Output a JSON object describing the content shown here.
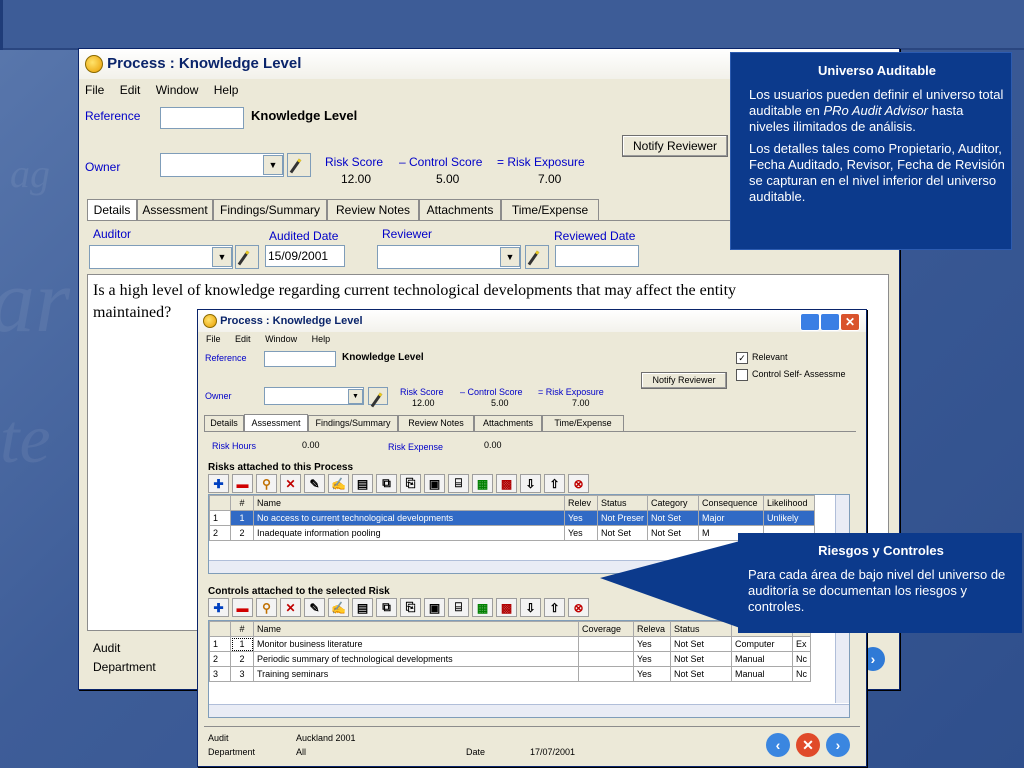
{
  "back_window": {
    "title": "Process : Knowledge Level",
    "menu": [
      "File",
      "Edit",
      "Window",
      "Help"
    ],
    "reference_label": "Reference",
    "reference_value": "Knowledge Level",
    "notify_button": "Notify Reviewer",
    "owner_label": "Owner",
    "risk_score_label": "Risk Score",
    "control_score_label": "– Control Score",
    "risk_exposure_label": "= Risk Exposure",
    "risk_score": "12.00",
    "control_score": "5.00",
    "risk_exposure": "7.00",
    "tabs": [
      "Details",
      "Assessment",
      "Findings/Summary",
      "Review Notes",
      "Attachments",
      "Time/Expense"
    ],
    "auditor_label": "Auditor",
    "audited_date_label": "Audited Date",
    "audited_date": "15/09/2001",
    "reviewer_label": "Reviewer",
    "reviewed_date_label": "Reviewed Date",
    "question": "Is a high level of knowledge regarding current technological developments that may affect the entity maintained?",
    "footer_audit": "Audit",
    "footer_department": "Department"
  },
  "front_window": {
    "title": "Process : Knowledge Level",
    "menu": [
      "File",
      "Edit",
      "Window",
      "Help"
    ],
    "reference_label": "Reference",
    "reference_value": "Knowledge Level",
    "relevant_label": "Relevant",
    "self_assess_label": "Control Self- Assessme",
    "notify_button": "Notify Reviewer",
    "owner_label": "Owner",
    "risk_score_label": "Risk Score",
    "control_score_label": "– Control Score",
    "risk_exposure_label": "= Risk Exposure",
    "risk_score": "12.00",
    "control_score": "5.00",
    "risk_exposure": "7.00",
    "tabs": [
      "Details",
      "Assessment",
      "Findings/Summary",
      "Review Notes",
      "Attachments",
      "Time/Expense"
    ],
    "risk_hours_label": "Risk Hours",
    "risk_hours": "0.00",
    "risk_expense_label": "Risk Expense",
    "risk_expense": "0.00",
    "risks_heading": "Risks attached to this Process",
    "risks_columns": [
      "",
      "#",
      "Name",
      "Relev",
      "Status",
      "Category",
      "Consequence",
      "Likelihood"
    ],
    "risks_rows": [
      [
        "1",
        "1",
        "No access to current technological developments",
        "Yes",
        "Not Preser",
        "Not Set",
        "Major",
        "Unlikely"
      ],
      [
        "2",
        "2",
        "Inadequate information pooling",
        "Yes",
        "Not Set",
        "Not Set",
        "M",
        ""
      ]
    ],
    "controls_heading": "Controls attached to the selected Risk",
    "controls_columns": [
      "",
      "#",
      "Name",
      "Coverage",
      "Releva",
      "Status",
      "",
      ""
    ],
    "controls_rows": [
      [
        "1",
        "1",
        "Monitor business literature",
        "",
        "Yes",
        "Not Set",
        "Computer",
        "Ex"
      ],
      [
        "2",
        "2",
        "Periodic summary of technological developments",
        "",
        "Yes",
        "Not Set",
        "Manual",
        "Nc"
      ],
      [
        "3",
        "3",
        "Training seminars",
        "",
        "Yes",
        "Not Set",
        "Manual",
        "Nc"
      ]
    ],
    "footer_audit_label": "Audit",
    "footer_audit_value": "Auckland 2001",
    "footer_department_label": "Department",
    "footer_department_value": "All",
    "footer_date_label": "Date",
    "footer_date_value": "17/07/2001"
  },
  "callout_top": {
    "title": "Universo Auditable",
    "p1a": "Los usuarios pueden definir el universo total auditable en ",
    "p1b": "PRo Audit Advisor",
    "p1c": "  hasta niveles ilimitados de análisis.",
    "p2": "Los detalles tales como Propietario, Auditor, Fecha Auditado, Revisor, Fecha de Revisión se capturan en el nivel inferior del universo auditable."
  },
  "callout_bottom": {
    "title": "Riesgos y Controles",
    "p1": "Para cada área de bajo nivel del universo de auditoría se documentan los riesgos y controles."
  },
  "colors": {
    "selection": "#316ac5",
    "callout": "#0c3a8c",
    "label_blue": "#0000c8"
  }
}
